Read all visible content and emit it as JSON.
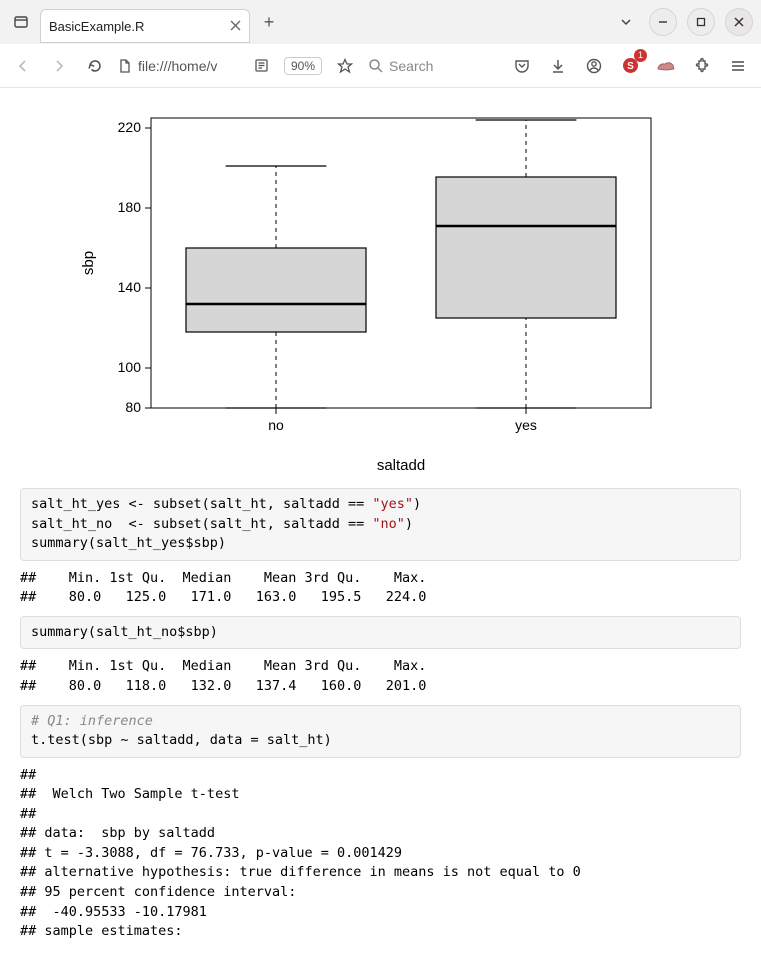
{
  "window": {
    "tab_title": "BasicExample.R",
    "new_tab_icon": "+"
  },
  "toolbar": {
    "url_prefix": "file:///home/v",
    "zoom": "90%",
    "search_placeholder": "Search",
    "badge_count": "1"
  },
  "chart_data": {
    "type": "boxplot",
    "xlabel": "saltadd",
    "ylabel": "sbp",
    "ylim": [
      80,
      225
    ],
    "yticks": [
      80,
      100,
      140,
      180,
      220
    ],
    "categories": [
      "no",
      "yes"
    ],
    "boxes": [
      {
        "category": "no",
        "min": 80,
        "q1": 118,
        "median": 132,
        "q3": 160,
        "max": 201
      },
      {
        "category": "yes",
        "min": 80,
        "q1": 125,
        "median": 171,
        "q3": 195.5,
        "max": 224
      }
    ]
  },
  "code1": {
    "l1a": "salt_ht_yes <- subset(salt_ht, saltadd == ",
    "l1s": "\"yes\"",
    "l1b": ")",
    "l2a": "salt_ht_no  <- subset(salt_ht, saltadd == ",
    "l2s": "\"no\"",
    "l2b": ")",
    "l3": "summary(salt_ht_yes$sbp)"
  },
  "out1_hdr": "##    Min. 1st Qu.  Median    Mean 3rd Qu.    Max. ",
  "out1_val": "##    80.0   125.0   171.0   163.0   195.5   224.0",
  "code2": "summary(salt_ht_no$sbp)",
  "out2_hdr": "##    Min. 1st Qu.  Median    Mean 3rd Qu.    Max. ",
  "out2_val": "##    80.0   118.0   132.0   137.4   160.0   201.0",
  "code3": {
    "comment": "# Q1: inference",
    "line": "t.test(sbp ~ saltadd, data = salt_ht)"
  },
  "out3": "## \n##  Welch Two Sample t-test\n## \n## data:  sbp by saltadd\n## t = -3.3088, df = 76.733, p-value = 0.001429\n## alternative hypothesis: true difference in means is not equal to 0\n## 95 percent confidence interval:\n##  -40.95533 -10.17981\n## sample estimates:"
}
